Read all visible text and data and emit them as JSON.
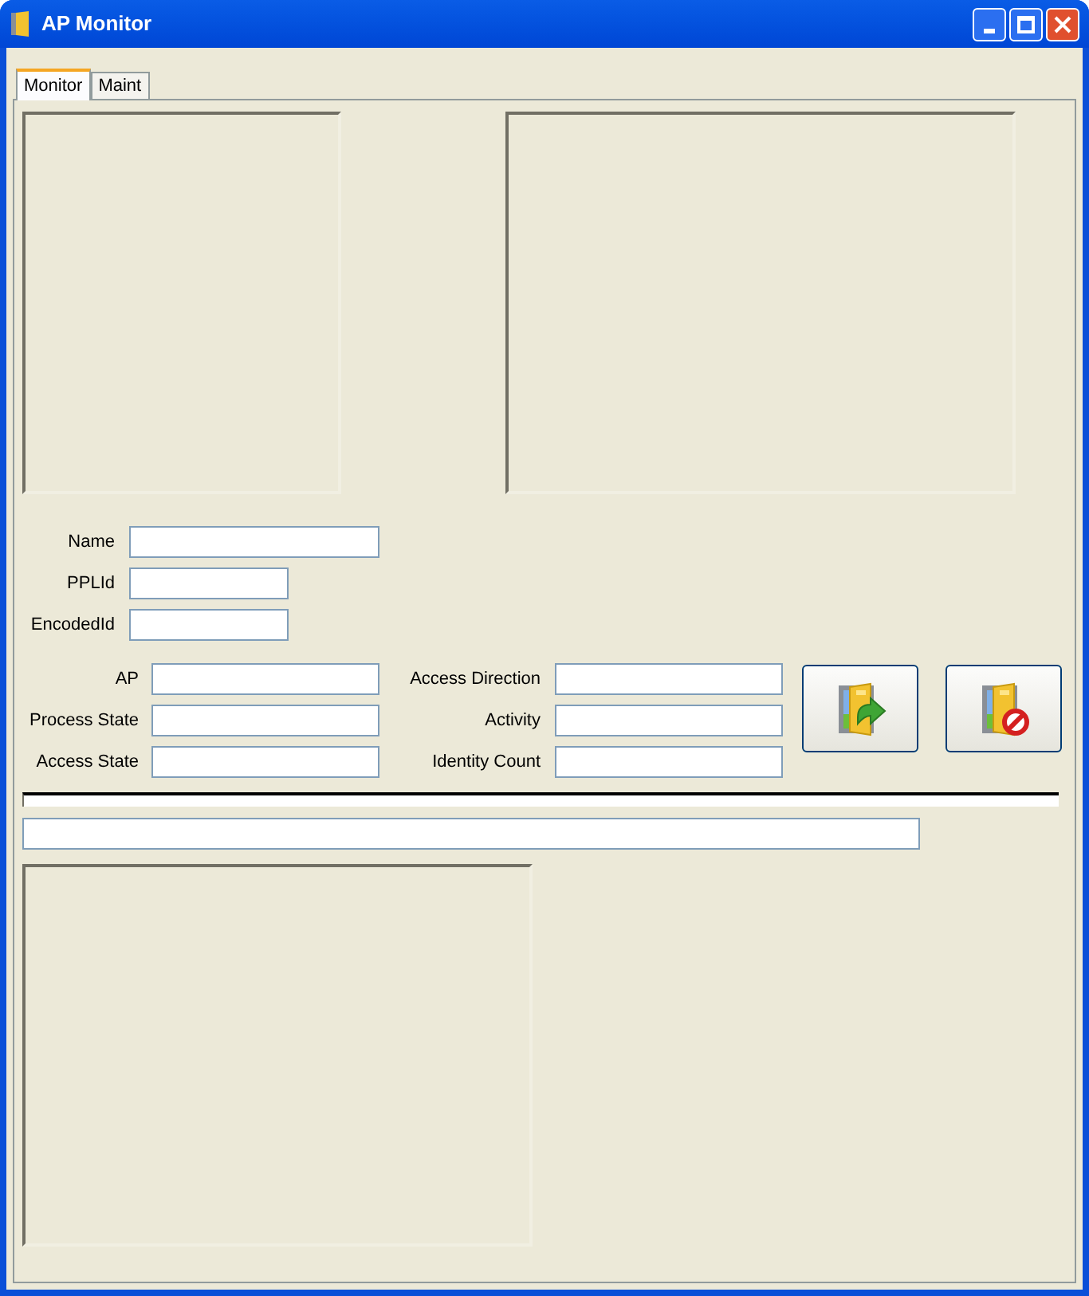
{
  "window": {
    "title": "AP Monitor"
  },
  "tabs": [
    {
      "label": "Monitor",
      "selected": true
    },
    {
      "label": "Maint",
      "selected": false
    }
  ],
  "identity_fields": [
    {
      "label": "Name",
      "kind": "wide"
    },
    {
      "label": "PPLId",
      "kind": "narrow"
    },
    {
      "label": "EncodedId",
      "kind": "narrow"
    }
  ],
  "state_fields_left": [
    {
      "label": "AP"
    },
    {
      "label": "Process State"
    },
    {
      "label": "Access State"
    }
  ],
  "state_fields_right": [
    {
      "label": "Access Direction"
    },
    {
      "label": "Activity"
    },
    {
      "label": "Identity Count"
    }
  ],
  "buttons": [
    {
      "kind": "enter"
    },
    {
      "kind": "deny"
    }
  ]
}
